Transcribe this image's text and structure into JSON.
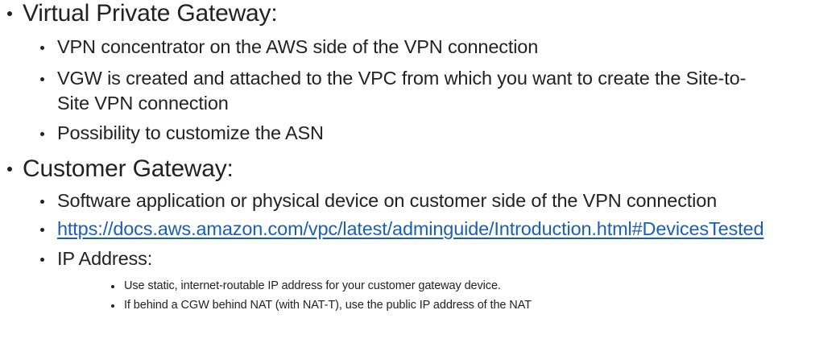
{
  "sections": [
    {
      "heading": "Virtual Private Gateway:",
      "items": [
        {
          "text": "VPN concentrator on the AWS side of the VPN connection"
        },
        {
          "text": "VGW is created and attached to the VPC from which you want to create the Site-to-",
          "continuation": "Site VPN connection"
        },
        {
          "text": "Possibility to customize the ASN"
        }
      ]
    },
    {
      "heading": "Customer Gateway:",
      "items": [
        {
          "text": "Software application or physical device on customer side of the VPN connection"
        },
        {
          "link": "https://docs.aws.amazon.com/vpc/latest/adminguide/Introduction.html#DevicesTested"
        },
        {
          "text": "IP Address:",
          "subitems": [
            "Use static, internet-routable IP address for your customer gateway device.",
            "If behind a CGW behind NAT (with NAT-T), use the public IP address of the NAT"
          ]
        }
      ]
    }
  ],
  "colors": {
    "text": "#222222",
    "link": "#1a5fb4",
    "background": "#ffffff"
  }
}
